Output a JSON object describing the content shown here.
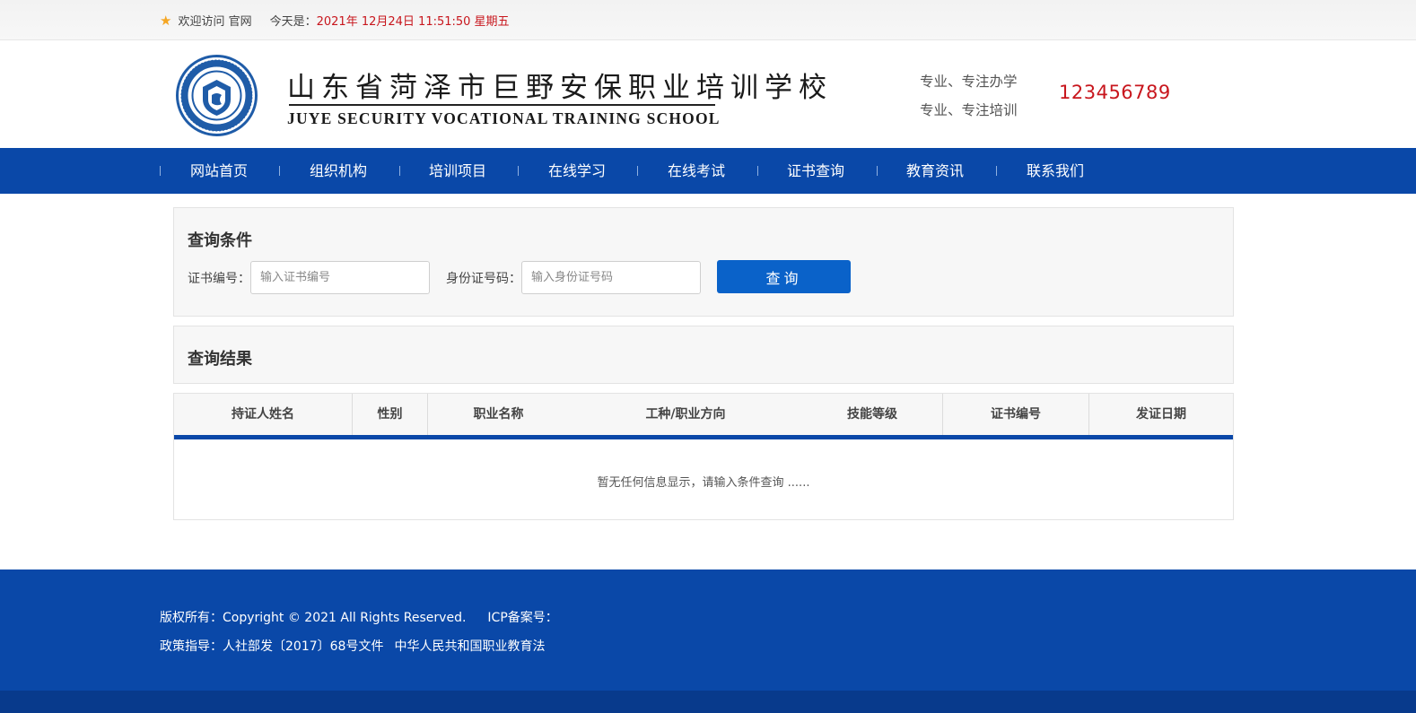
{
  "topbar": {
    "welcome": "欢迎访问 官网",
    "today_label": "今天是：",
    "today_value": "2021年 12月24日  11:51:50  星期五"
  },
  "header": {
    "school_name_cn": "山东省菏泽市巨野安保职业培训学校",
    "school_name_en": "JUYE SECURITY VOCATIONAL TRAINING SCHOOL",
    "slogan_1": "专业、专注办学",
    "slogan_2": "专业、专注培训",
    "phone": "123456789",
    "brand_color": "#0a48a8",
    "accent_color": "#c8161d"
  },
  "nav": {
    "items": [
      {
        "label": "网站首页"
      },
      {
        "label": "组织机构"
      },
      {
        "label": "培训项目"
      },
      {
        "label": "在线学习"
      },
      {
        "label": "在线考试"
      },
      {
        "label": "证书查询"
      },
      {
        "label": "教育资讯"
      },
      {
        "label": "联系我们"
      }
    ]
  },
  "query": {
    "title": "查询条件",
    "cert_label": "证书编号：",
    "cert_placeholder": "输入证书编号",
    "id_label": "身份证号码：",
    "id_placeholder": "输入身份证号码",
    "button": "查询"
  },
  "result": {
    "title": "查询结果",
    "columns": [
      "持证人姓名",
      "性别",
      "职业名称",
      "工种/职业方向",
      "技能等级",
      "证书编号",
      "发证日期"
    ],
    "empty_text": "暂无任何信息显示，请输入条件查询 ......"
  },
  "footer": {
    "copyright": "版权所有：Copyright © 2021 All Rights Reserved.",
    "icp": "ICP备案号：",
    "policy": "政策指导：人社部发〔2017〕68号文件",
    "law": "中华人民共和国职业教育法"
  }
}
